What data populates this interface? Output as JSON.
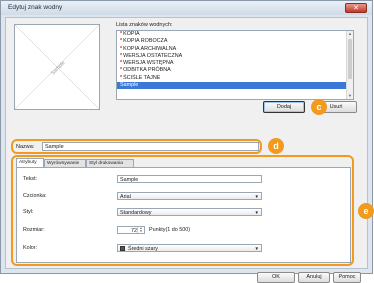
{
  "window": {
    "title": "Edytuj znak wodny",
    "close_glyph": "✕"
  },
  "preview": {
    "sample_text": "Sample"
  },
  "watermark_list": {
    "label": "Lista znaków wodnych:",
    "items": [
      {
        "label": "KOPIA",
        "starred": true
      },
      {
        "label": "KOPIA ROBOCZA",
        "starred": true
      },
      {
        "label": "KOPIA ARCHIWALNA",
        "starred": true
      },
      {
        "label": "WERSJA OSTATECZNA",
        "starred": true
      },
      {
        "label": "WERSJA WSTĘPNA",
        "starred": true
      },
      {
        "label": "ODBITKA PRÓBNA",
        "starred": true
      },
      {
        "label": "ŚCIŚLE TAJNE",
        "starred": true
      },
      {
        "label": "Sample",
        "starred": false,
        "selected": true
      }
    ]
  },
  "buttons": {
    "add": "Dodaj",
    "delete": "Usuń",
    "ok": "OK",
    "cancel": "Anuluj",
    "help": "Pomoc"
  },
  "callouts": {
    "c": "c",
    "d": "d",
    "e": "e"
  },
  "name": {
    "label": "Nazwa:",
    "value": "Sample"
  },
  "tabs": [
    {
      "label": "Atrybuty",
      "active": true
    },
    {
      "label": "Wyrównywanie",
      "active": false
    },
    {
      "label": "Styl drukowania",
      "active": false
    }
  ],
  "attributes": {
    "text_label": "Tekst:",
    "text_value": "Sample",
    "font_label": "Czcionka:",
    "font_value": "Arial",
    "style_label": "Styl:",
    "style_value": "Standardowy",
    "size_label": "Rozmiar:",
    "size_value": "72",
    "size_range": "Punkty(1 do 500)",
    "color_label": "Kolor:",
    "color_value": "Średni szary",
    "color_swatch": "#555555"
  },
  "colors": {
    "accent": "#f19a1e",
    "selection": "#3b78d8",
    "star": "#d8232a"
  }
}
